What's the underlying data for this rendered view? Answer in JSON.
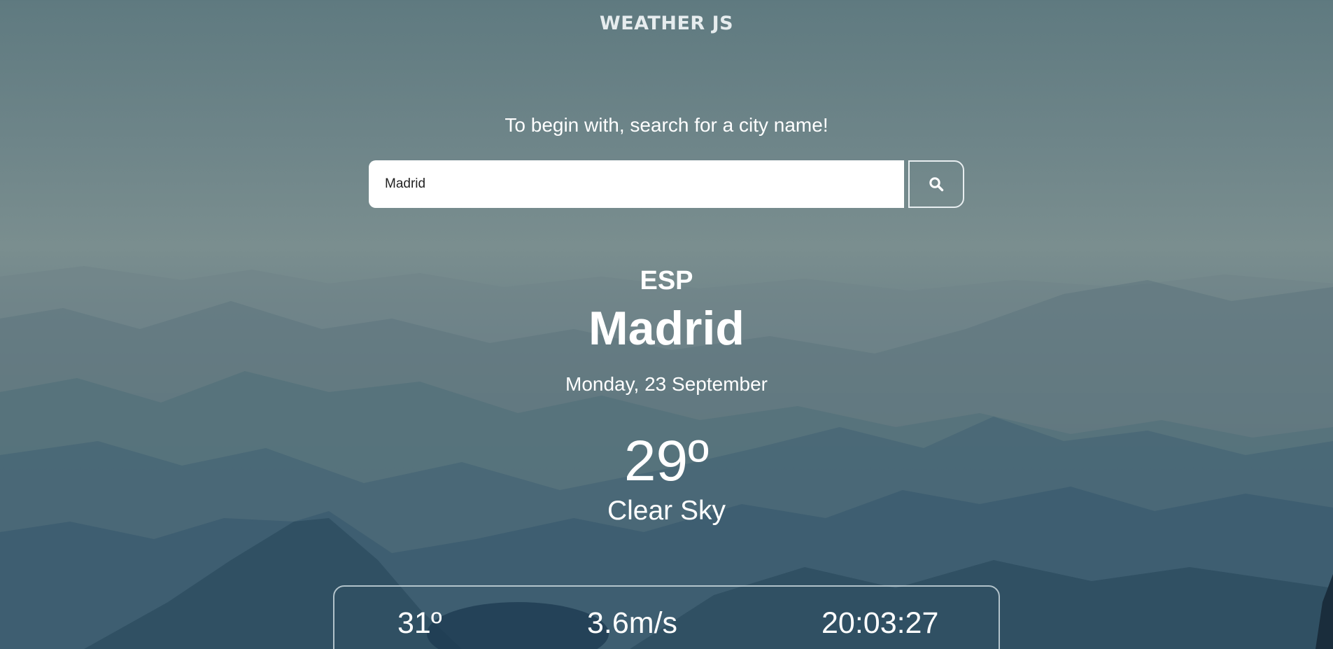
{
  "app": {
    "title": "WEATHER JS"
  },
  "search": {
    "prompt": "To begin with, search for a city name!",
    "value": "Madrid",
    "button_icon": "search-icon"
  },
  "weather": {
    "country": "ESP",
    "city": "Madrid",
    "date": "Monday, 23 September",
    "temperature": "29º",
    "condition": "Clear Sky"
  },
  "stats": {
    "max_temp": "31º",
    "wind": "3.6m/s",
    "time": "20:03:27"
  },
  "colors": {
    "text": "#ffffff",
    "input_bg": "#ffffff",
    "mountain_mist": "#7a8e8f",
    "mountain_dark": "#2e4e60"
  }
}
